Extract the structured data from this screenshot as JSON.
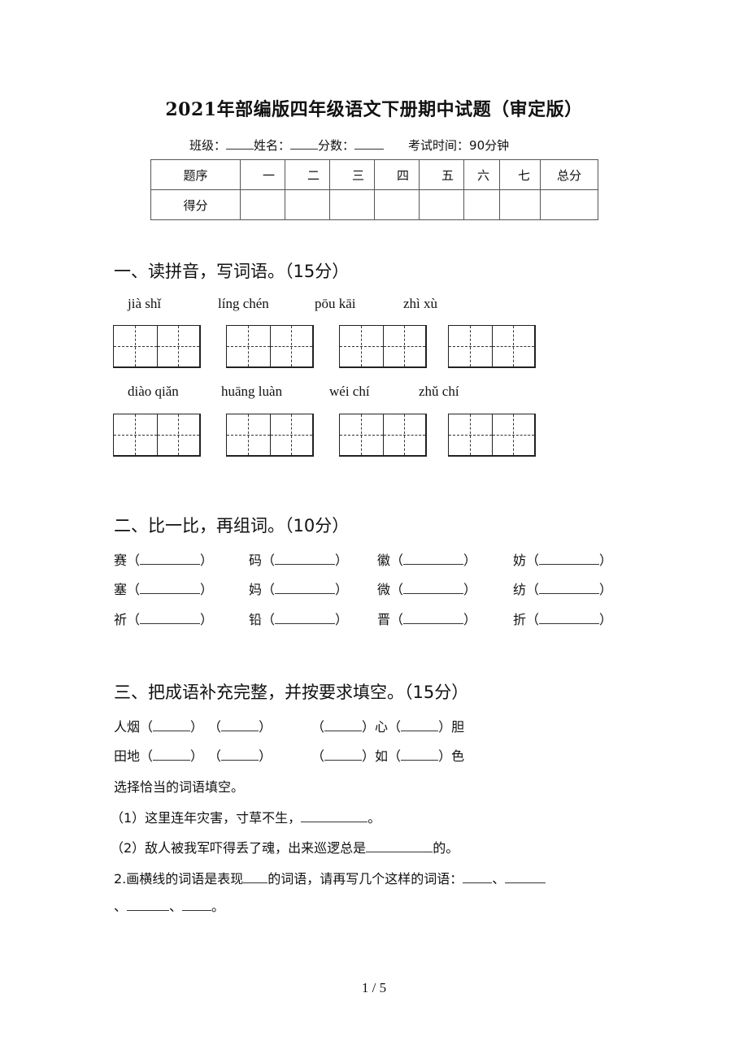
{
  "title": "2021年部编版四年级语文下册期中试题（审定版）",
  "info": {
    "class_label": "班级：",
    "name_label": "姓名：",
    "score_label": "分数：",
    "time_label": "考试时间：90分钟"
  },
  "score_table": {
    "header": [
      "题序",
      "一",
      "二",
      "三",
      "四",
      "五",
      "六",
      "七",
      "总分"
    ],
    "row_label": "得分",
    "row_values": [
      "",
      "",
      "",
      "",
      "",
      "",
      "",
      ""
    ]
  },
  "section1": {
    "title": "一、读拼音，写词语。（15分）",
    "row1": [
      "jià shǐ",
      "líng chén",
      "pōu kāi",
      "zhì xù"
    ],
    "row2": [
      "diào qiǎn",
      "huāng luàn",
      "wéi chí",
      "zhǔ chí"
    ]
  },
  "section2": {
    "title": "二、比一比，再组词。（10分）",
    "rows": [
      [
        "赛",
        "码",
        "徽",
        "妨"
      ],
      [
        "塞",
        "妈",
        "微",
        "纺"
      ],
      [
        "祈",
        "铅",
        "晋",
        "折"
      ]
    ],
    "open": "（",
    "close": "）"
  },
  "section3": {
    "title": "三、把成语补充完整，并按要求填空。（15分）",
    "idioms": [
      {
        "left_prefix": "人烟",
        "right_mid": "心",
        "right_end": "胆"
      },
      {
        "left_prefix": "田地",
        "right_mid": "如",
        "right_end": "色"
      }
    ],
    "open": "（",
    "close": "）",
    "instruction": "选择恰当的词语填空。",
    "q1_prefix": "（1）这里连年灾害，寸草不生，",
    "q1_suffix": "。",
    "q2_prefix": "（2）敌人被我军吓得丢了魂，出来巡逻总是",
    "q2_suffix": "的。",
    "q3_part1": "2.画横线的词语是表现",
    "q3_part2": "的词语，请再写几个这样的词语：",
    "q3_sep": "、",
    "q3_end": "。"
  },
  "page_number": "1 / 5"
}
